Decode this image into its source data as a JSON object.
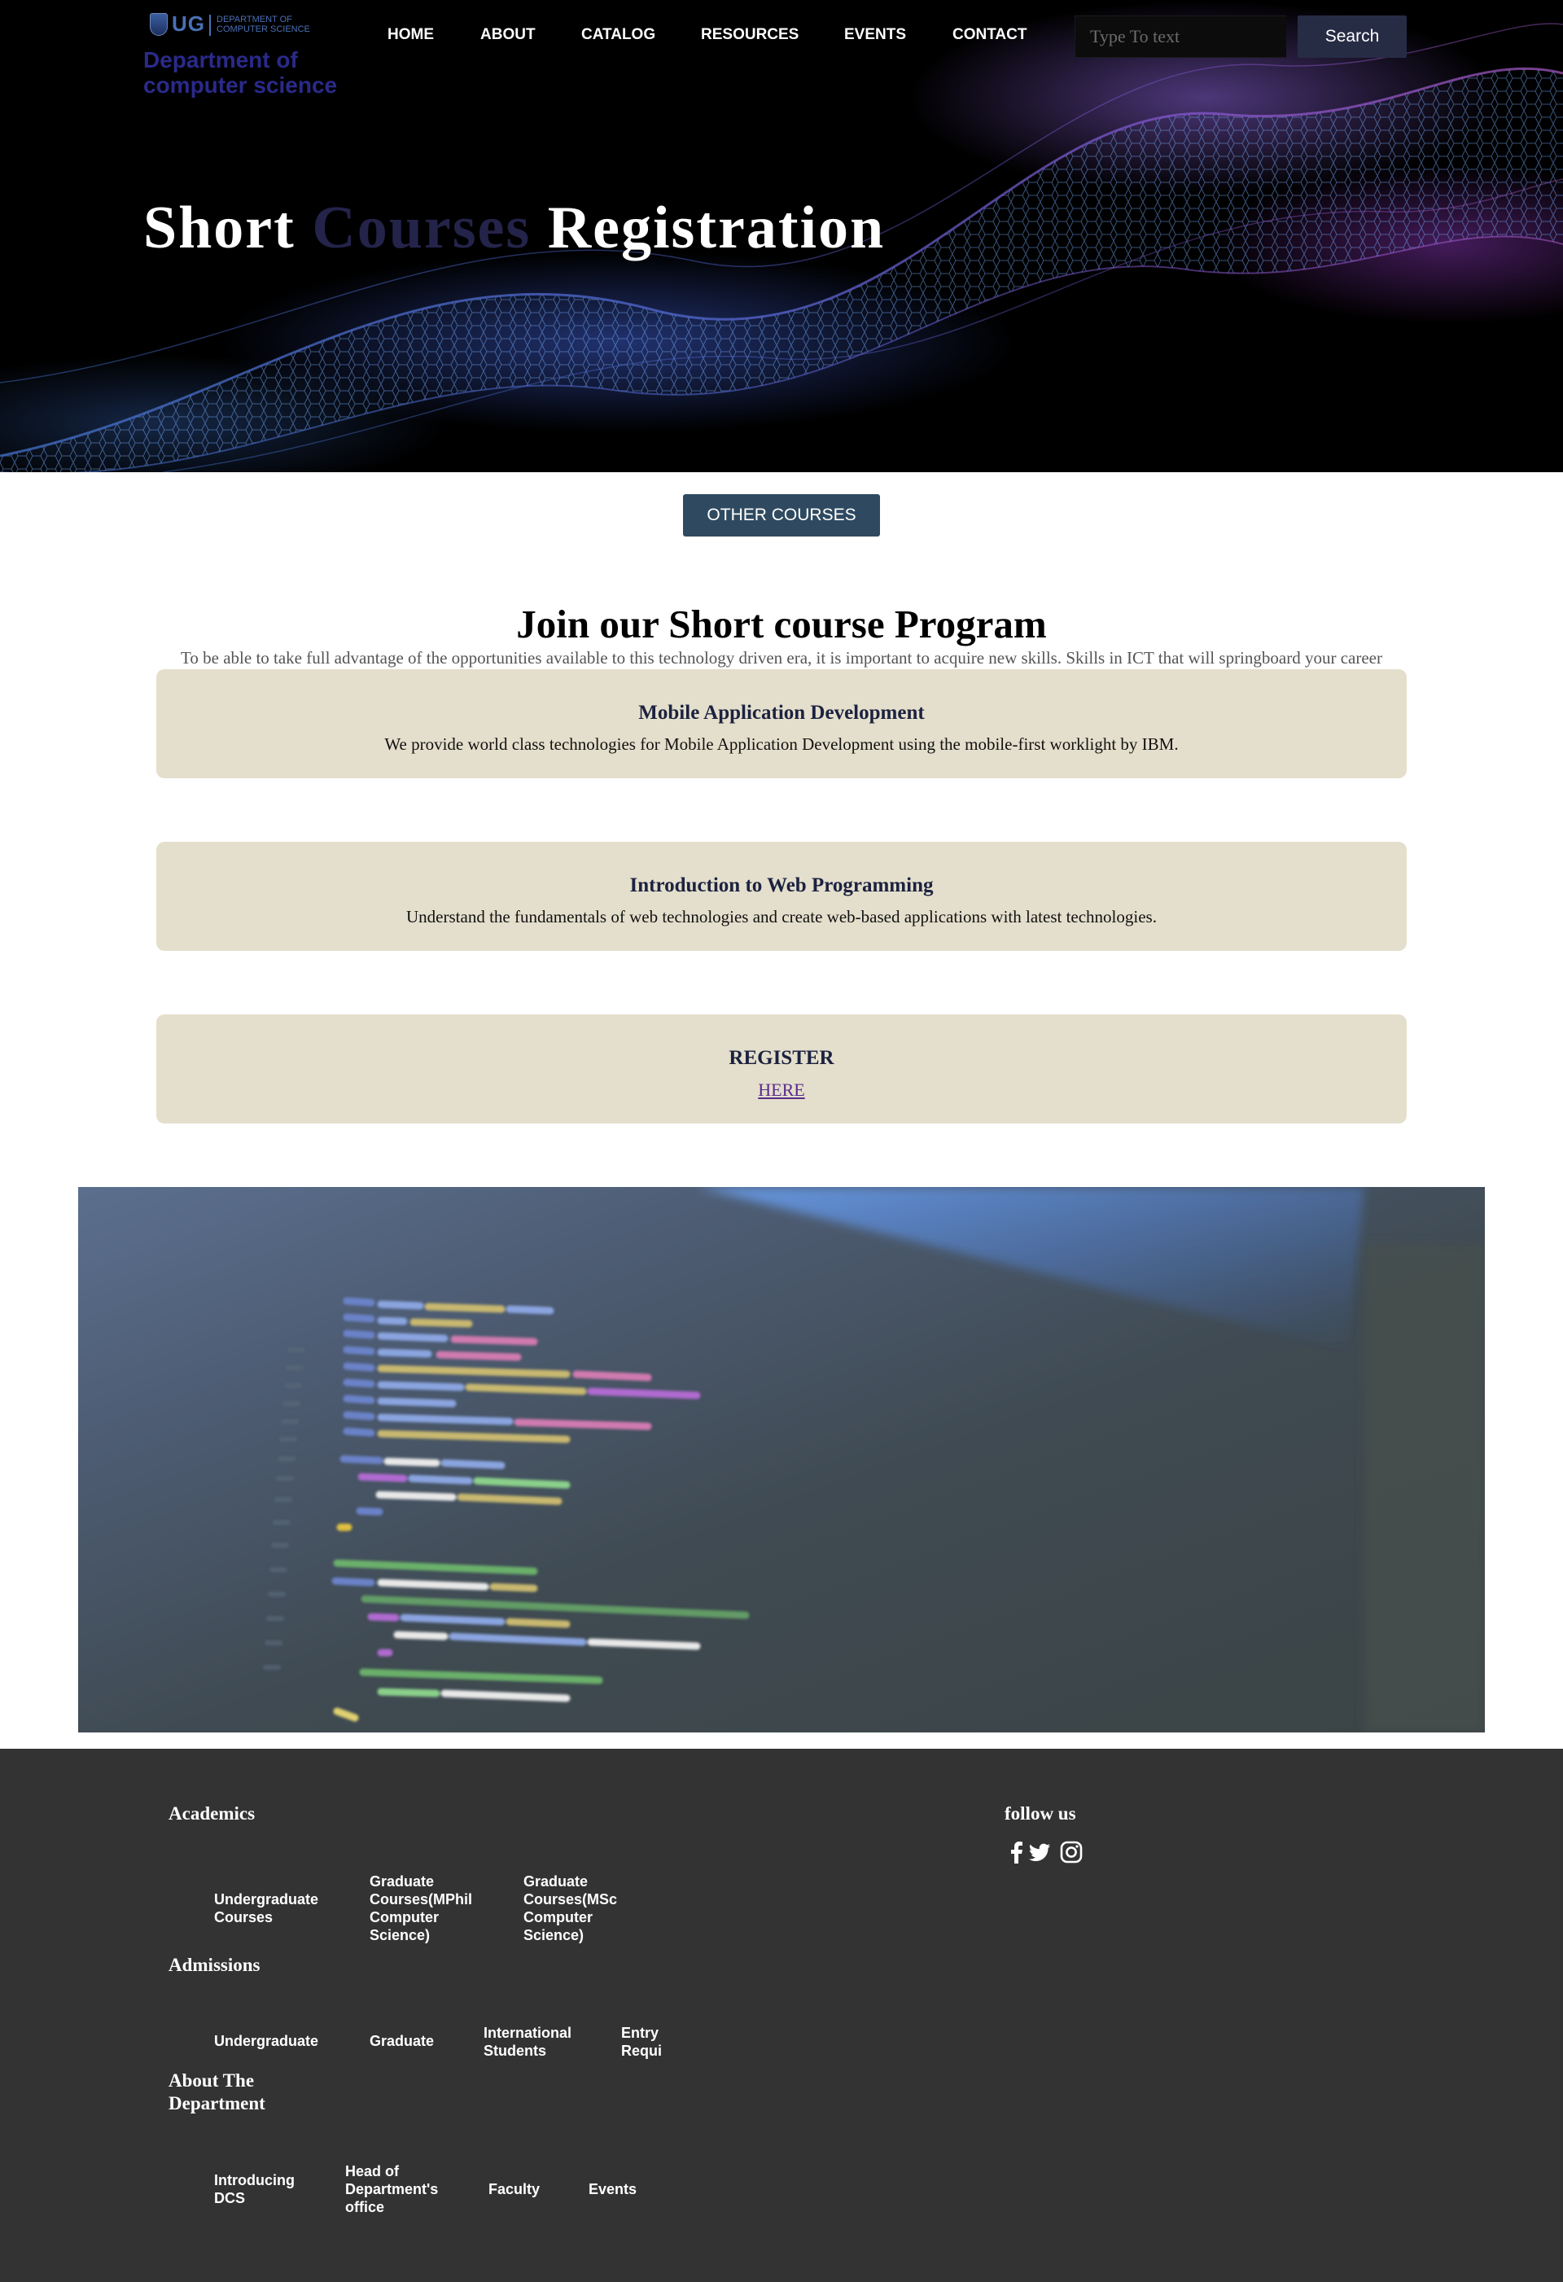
{
  "header": {
    "logo": {
      "wordmark": "UG",
      "dept_line1": "DEPARTMENT OF",
      "dept_line2": "COMPUTER SCIENCE"
    },
    "site_name_line1": "Department of",
    "site_name_line2": "computer science",
    "nav": [
      {
        "label": "HOME"
      },
      {
        "label": "ABOUT"
      },
      {
        "label": "CATALOG"
      },
      {
        "label": "RESOURCES"
      },
      {
        "label": "EVENTS"
      },
      {
        "label": "CONTACT"
      }
    ],
    "search": {
      "placeholder": "Type To text",
      "value": "",
      "button_label": "Search"
    }
  },
  "hero": {
    "title_part1": "Short ",
    "title_accent": "Courses",
    "title_part2": " Registration"
  },
  "other_courses_button": "OTHER COURSES",
  "intro": {
    "title": "Join our Short course Program",
    "subtitle": "To be able to take full advantage of the opportunities available to this technology driven era, it is important to acquire new skills. Skills in ICT that will springboard your career"
  },
  "courses": [
    {
      "title": "Mobile Application Development",
      "description": "We provide world class technologies for Mobile Application Development using the mobile-first worklight by IBM."
    },
    {
      "title": "Introduction to Web Programming",
      "description": "Understand the fundamentals of web technologies and create web-based applications with latest technologies."
    }
  ],
  "register": {
    "title": "REGISTER",
    "link_label": "HERE"
  },
  "footer": {
    "academics": {
      "heading": "Academics",
      "links": [
        {
          "label": "Undergraduate Courses"
        },
        {
          "label": "Graduate Courses(MPhil Computer Science)"
        },
        {
          "label": "Graduate Courses(MSc Computer Science)"
        }
      ]
    },
    "admissions": {
      "heading": "Admissions",
      "links": [
        {
          "label": "Undergraduate"
        },
        {
          "label": "Graduate"
        },
        {
          "label": "International Students"
        },
        {
          "label": "Entry Requi"
        }
      ]
    },
    "about": {
      "heading_line1": "About The",
      "heading_line2": "Department",
      "links": [
        {
          "label": "Introducing DCS"
        },
        {
          "label": "Head of Department's office"
        },
        {
          "label": "Faculty"
        },
        {
          "label": "Events"
        }
      ]
    },
    "follow": {
      "heading": "follow us",
      "icons": [
        "facebook-icon",
        "twitter-icon",
        "instagram-icon"
      ]
    }
  },
  "colors": {
    "hero_accent_text": "#24234a",
    "site_name": "#2a2a8a",
    "card_background": "#e4dfcc",
    "other_courses_button": "#2f4a60",
    "search_button": "#272c45",
    "footer_background": "#333333",
    "register_link": "#5a2a8a"
  }
}
